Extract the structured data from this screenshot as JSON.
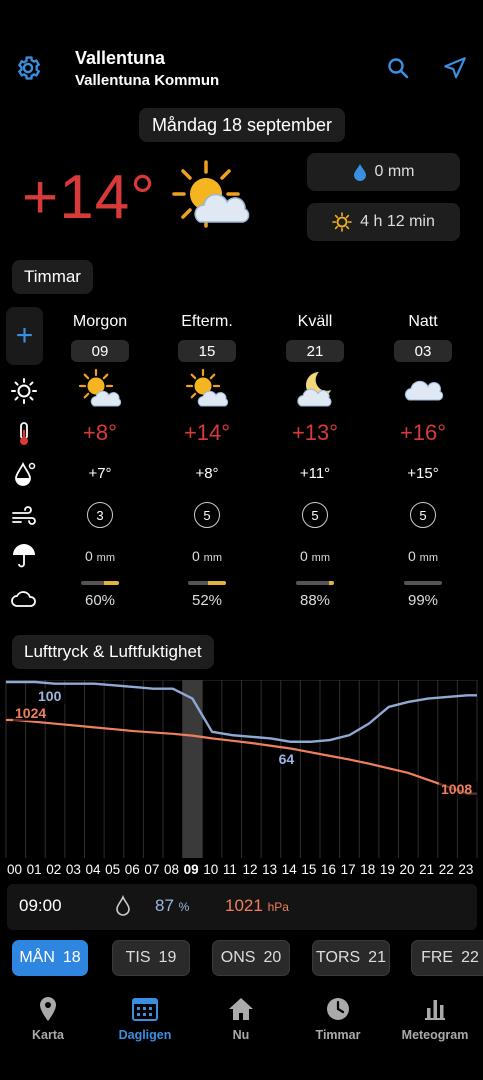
{
  "header": {
    "city": "Vallentuna",
    "municipality": "Vallentuna Kommun"
  },
  "date": "Måndag 18 september",
  "current": {
    "temp": "+14°",
    "rain": "0 mm",
    "sun": "4 h 12 min"
  },
  "sections": {
    "hours": "Timmar",
    "pressure": "Lufttryck & Luftfuktighet"
  },
  "periods": [
    {
      "label": "Morgon",
      "hour": "09",
      "temp": "+8°",
      "feels": "+7°",
      "wind": "3",
      "rain": "0",
      "rain_unit": "mm",
      "cloud": "60%",
      "cloud_fraction": 0.4,
      "icon": "sun-cloud-icon"
    },
    {
      "label": "Efterm.",
      "hour": "15",
      "temp": "+14°",
      "feels": "+8°",
      "wind": "5",
      "rain": "0",
      "rain_unit": "mm",
      "cloud": "52%",
      "cloud_fraction": 0.48,
      "icon": "sun-cloud-icon"
    },
    {
      "label": "Kväll",
      "hour": "21",
      "temp": "+13°",
      "feels": "+11°",
      "wind": "5",
      "rain": "0",
      "rain_unit": "mm",
      "cloud": "88%",
      "cloud_fraction": 0.12,
      "icon": "moon-cloud-icon"
    },
    {
      "label": "Natt",
      "hour": "03",
      "temp": "+16°",
      "feels": "+15°",
      "wind": "5",
      "rain": "0",
      "rain_unit": "mm",
      "cloud": "99%",
      "cloud_fraction": 0.01,
      "icon": "cloud-icon"
    }
  ],
  "chart_data": {
    "type": "line",
    "x": [
      "00",
      "01",
      "02",
      "03",
      "04",
      "05",
      "06",
      "07",
      "08",
      "09",
      "10",
      "11",
      "12",
      "13",
      "14",
      "15",
      "16",
      "17",
      "18",
      "19",
      "20",
      "21",
      "22",
      "23"
    ],
    "current_hour": "09",
    "series": [
      {
        "values": [
          100,
          100,
          99,
          99,
          99,
          98,
          97,
          96,
          96,
          90,
          70,
          68,
          67,
          66,
          64,
          64,
          65,
          68,
          75,
          85,
          88,
          90,
          91,
          92
        ],
        "color": "#8fa9d4"
      },
      {
        "values": [
          1024,
          1023.6,
          1023.2,
          1022.8,
          1022.4,
          1022,
          1021.6,
          1021.3,
          1021,
          1020.6,
          1020,
          1019.5,
          1019,
          1018.4,
          1017.8,
          1017,
          1016.2,
          1015.4,
          1014.5,
          1013.5,
          1012.5,
          1011,
          1009.5,
          1008
        ],
        "color": "#ef7f5d"
      }
    ],
    "labels": {
      "hum_start": "100",
      "hum_min": "64",
      "pres_start": "1024",
      "pres_end": "1008"
    }
  },
  "readout": {
    "time": "09:00",
    "humidity": "87",
    "humidity_unit": "%",
    "pressure": "1021",
    "pressure_unit": "hPa"
  },
  "days": [
    {
      "name": "MÅN",
      "num": "18"
    },
    {
      "name": "TIS",
      "num": "19"
    },
    {
      "name": "ONS",
      "num": "20"
    },
    {
      "name": "TORS",
      "num": "21"
    },
    {
      "name": "FRE",
      "num": "22"
    }
  ],
  "nav": [
    "Karta",
    "Dagligen",
    "Nu",
    "Timmar",
    "Meteogram"
  ],
  "colors": {
    "accent": "#2f86e0",
    "temp": "#d83a3a",
    "humidity": "#8fa9d4",
    "pressure": "#ef7f5d"
  }
}
